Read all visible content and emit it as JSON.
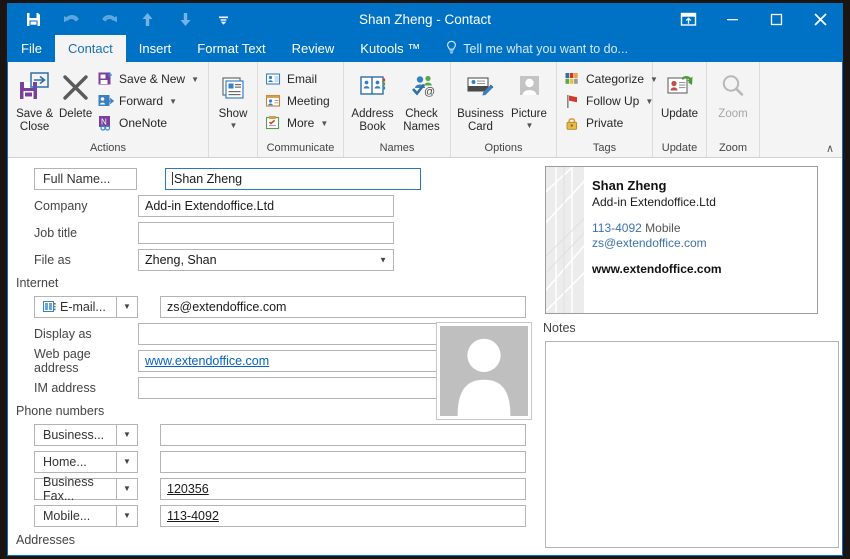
{
  "window": {
    "title": "Shan Zheng - Contact",
    "accent_color": "#0072c6",
    "controls": {
      "ribbon_display_options": "ribbon-display-options",
      "minimize": "minimize",
      "restore": "restore",
      "close": "close"
    }
  },
  "quick_access": [
    {
      "name": "save-icon",
      "label": "Save"
    },
    {
      "name": "undo-icon",
      "label": "Undo"
    },
    {
      "name": "redo-icon",
      "label": "Redo"
    },
    {
      "name": "previous-item-icon",
      "label": "Previous Item"
    },
    {
      "name": "next-item-icon",
      "label": "Next Item"
    },
    {
      "name": "customize-quick-access-icon",
      "label": "Customize Quick Access Toolbar"
    }
  ],
  "tabs": [
    {
      "label": "File",
      "active": false
    },
    {
      "label": "Contact",
      "active": true
    },
    {
      "label": "Insert",
      "active": false
    },
    {
      "label": "Format Text",
      "active": false
    },
    {
      "label": "Review",
      "active": false
    },
    {
      "label": "Kutools ™",
      "active": false
    }
  ],
  "tell_me": "Tell me what you want to do...",
  "ribbon": {
    "collapse_label": "∧",
    "groups": [
      {
        "label": "Actions",
        "big_buttons": [
          {
            "label": "Save & Close",
            "icon": "save-and-close-icon",
            "disabled": false
          },
          {
            "label": "Delete",
            "icon": "delete-icon",
            "disabled": false
          }
        ],
        "small_buttons": [
          {
            "label": "Save & New",
            "icon": "save-and-new-icon",
            "has_caret": true
          },
          {
            "label": "Forward",
            "icon": "forward-icon",
            "has_caret": true
          },
          {
            "label": "OneNote",
            "icon": "onenote-icon",
            "has_caret": false
          }
        ]
      },
      {
        "label": "",
        "big_buttons": [
          {
            "label": "Show",
            "icon": "show-icon",
            "disabled": false,
            "has_caret": true
          }
        ],
        "small_buttons": []
      },
      {
        "label": "Communicate",
        "big_buttons": [],
        "small_buttons": [
          {
            "label": "Email",
            "icon": "email-icon",
            "has_caret": false
          },
          {
            "label": "Meeting",
            "icon": "meeting-icon",
            "has_caret": false
          },
          {
            "label": "More",
            "icon": "more-icon",
            "has_caret": true
          }
        ]
      },
      {
        "label": "Names",
        "big_buttons": [
          {
            "label": "Address Book",
            "icon": "address-book-icon",
            "disabled": false
          },
          {
            "label": "Check Names",
            "icon": "check-names-icon",
            "disabled": false
          }
        ],
        "small_buttons": []
      },
      {
        "label": "Options",
        "big_buttons": [
          {
            "label": "Business Card",
            "icon": "business-card-icon",
            "disabled": false
          },
          {
            "label": "Picture",
            "icon": "picture-icon",
            "disabled": false,
            "has_caret": true
          }
        ],
        "small_buttons": []
      },
      {
        "label": "Tags",
        "big_buttons": [],
        "small_buttons": [
          {
            "label": "Categorize",
            "icon": "categorize-icon",
            "has_caret": true
          },
          {
            "label": "Follow Up",
            "icon": "follow-up-flag-icon",
            "has_caret": true
          },
          {
            "label": "Private",
            "icon": "lock-icon",
            "has_caret": false
          }
        ]
      },
      {
        "label": "Update",
        "big_buttons": [
          {
            "label": "Update",
            "icon": "update-contact-icon",
            "disabled": false
          }
        ],
        "small_buttons": []
      },
      {
        "label": "Zoom",
        "big_buttons": [
          {
            "label": "Zoom",
            "icon": "zoom-magnifier-icon",
            "disabled": true
          }
        ],
        "small_buttons": []
      }
    ]
  },
  "form": {
    "full_name": {
      "label": "Full Name...",
      "value": "Shan Zheng"
    },
    "company": {
      "label": "Company",
      "value": "Add-in Extendoffice.Ltd"
    },
    "job_title": {
      "label": "Job title",
      "value": ""
    },
    "file_as": {
      "label": "File as",
      "value": "Zheng, Shan"
    },
    "internet_header": "Internet",
    "email": {
      "label": "E-mail...",
      "value": "zs@extendoffice.com"
    },
    "display_as": {
      "label": "Display as",
      "value": ""
    },
    "web_page": {
      "label": "Web page address",
      "value": "www.extendoffice.com"
    },
    "im_address": {
      "label": "IM address",
      "value": ""
    },
    "phone_header": "Phone numbers",
    "phones": [
      {
        "label": "Business...",
        "value": ""
      },
      {
        "label": "Home...",
        "value": ""
      },
      {
        "label": "Business Fax...",
        "value": "120356"
      },
      {
        "label": "Mobile...",
        "value": "113-4092"
      }
    ],
    "addresses_header": "Addresses",
    "photo_alt": "contact-photo-placeholder"
  },
  "business_card": {
    "name": "Shan Zheng",
    "company": "Add-in Extendoffice.Ltd",
    "phone": "113-4092",
    "phone_type": "Mobile",
    "email": "zs@extendoffice.com",
    "website": "www.extendoffice.com"
  },
  "notes": {
    "label": "Notes",
    "value": ""
  }
}
